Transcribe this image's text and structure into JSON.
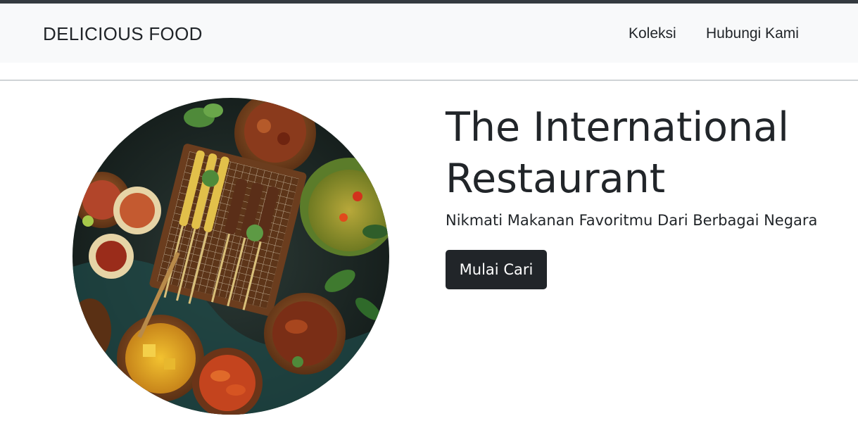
{
  "navbar": {
    "brand": "DELICIOUS FOOD",
    "links": [
      {
        "label": "Koleksi"
      },
      {
        "label": "Hubungi Kami"
      }
    ]
  },
  "hero": {
    "title_line1": "The International",
    "title_line2": "Restaurant",
    "subtitle": "Nikmati Makanan Favoritmu Dari Berbagai Negara",
    "button_label": "Mulai Cari"
  },
  "colors": {
    "navbar_bg": "#f8f9fa",
    "top_border": "#343a40",
    "text": "#212529",
    "button_bg": "#212529",
    "button_text": "#ffffff"
  }
}
